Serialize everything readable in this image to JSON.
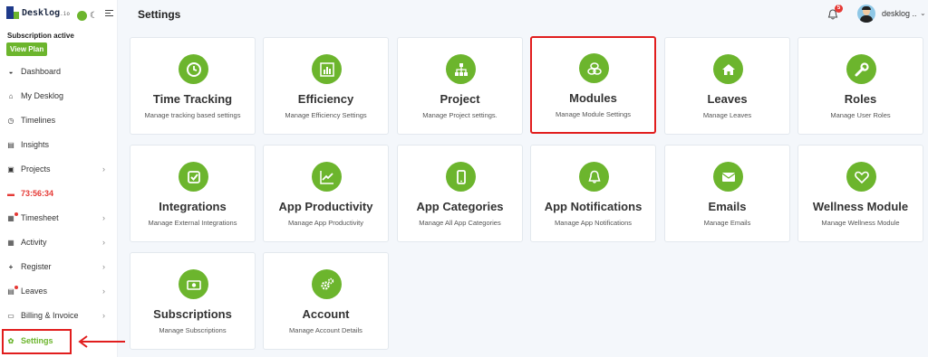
{
  "app": {
    "logo_text": "Desklog",
    "logo_suffix": ".io",
    "page_title": "Settings"
  },
  "subscription": {
    "status": "Subscription active",
    "view_plan_label": "View Plan"
  },
  "sidebar": {
    "items": [
      {
        "label": "Dashboard",
        "icon": "dashboard-icon",
        "chevron": false
      },
      {
        "label": "My Desklog",
        "icon": "home-icon",
        "chevron": false
      },
      {
        "label": "Timelines",
        "icon": "clock-icon",
        "chevron": false
      },
      {
        "label": "Insights",
        "icon": "book-icon",
        "chevron": false
      },
      {
        "label": "Projects",
        "icon": "folder-icon",
        "chevron": true
      },
      {
        "label": "73:56:34",
        "icon": "timer-icon",
        "chevron": false
      },
      {
        "label": "Timesheet",
        "icon": "timesheet-icon",
        "chevron": true
      },
      {
        "label": "Activity",
        "icon": "grid-icon",
        "chevron": true
      },
      {
        "label": "Register",
        "icon": "plus-icon",
        "chevron": true
      },
      {
        "label": "Leaves",
        "icon": "calendar-icon",
        "chevron": true
      },
      {
        "label": "Billing & Invoice",
        "icon": "invoice-icon",
        "chevron": true
      },
      {
        "label": "Settings",
        "icon": "gear-icon",
        "chevron": false
      }
    ]
  },
  "header": {
    "notification_count": "5",
    "user_name": "desklog ..",
    "user_chevron": "⌄"
  },
  "cards": [
    {
      "title": "Time Tracking",
      "desc": "Manage tracking based settings",
      "icon": "clock-icon"
    },
    {
      "title": "Efficiency",
      "desc": "Manage Efficiency Settings",
      "icon": "bar-chart-icon"
    },
    {
      "title": "Project",
      "desc": "Manage Project settings.",
      "icon": "sitemap-icon"
    },
    {
      "title": "Modules",
      "desc": "Manage Module Settings",
      "icon": "cubes-icon"
    },
    {
      "title": "Leaves",
      "desc": "Manage Leaves",
      "icon": "home-icon"
    },
    {
      "title": "Roles",
      "desc": "Manage User Roles",
      "icon": "wrench-icon"
    },
    {
      "title": "Integrations",
      "desc": "Manage External Integrations",
      "icon": "check-square-icon"
    },
    {
      "title": "App Productivity",
      "desc": "Manage App Productivity",
      "icon": "trend-chart-icon"
    },
    {
      "title": "App Categories",
      "desc": "Manage All App Categories",
      "icon": "mobile-icon"
    },
    {
      "title": "App Notifications",
      "desc": "Manage App Notifications",
      "icon": "bell-icon"
    },
    {
      "title": "Emails",
      "desc": "Manage Emails",
      "icon": "envelope-icon"
    },
    {
      "title": "Wellness Module",
      "desc": "Manage Wellness Module",
      "icon": "heart-icon"
    },
    {
      "title": "Subscriptions",
      "desc": "Manage Subscriptions",
      "icon": "money-icon"
    },
    {
      "title": "Account",
      "desc": "Manage Account Details",
      "icon": "cogs-icon"
    }
  ],
  "colors": {
    "accent": "#6cb52d",
    "highlight": "#e11d1d",
    "timer": "#e53935"
  }
}
